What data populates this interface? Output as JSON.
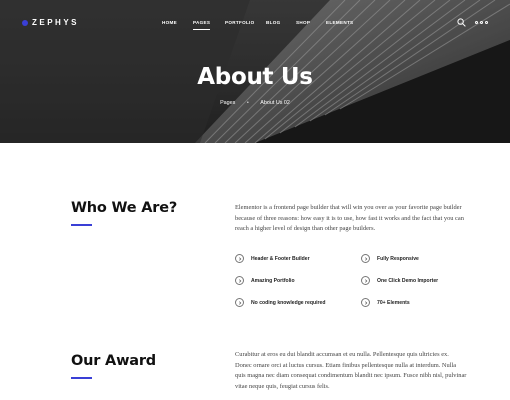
{
  "header": {
    "logo_text": "ZEPHYS",
    "nav": [
      {
        "label": "HOME"
      },
      {
        "label": "PAGES"
      },
      {
        "label": "PORTFOLIO"
      },
      {
        "label": "BLOG"
      },
      {
        "label": "SHOP"
      },
      {
        "label": "ELEMENTS"
      }
    ],
    "active_nav": "PAGES",
    "search_icon": "search-icon",
    "menu_icon": "more-dots-icon"
  },
  "hero": {
    "title": "About Us",
    "breadcrumb": [
      "Pages",
      "About Us 02"
    ]
  },
  "who": {
    "heading": "Who We Are?",
    "text": "Elementor is a frontend page builder that will win you over as your favorite page builder because of three reasons: how easy it is to use, how fast it works and the fact that you can reach a higher level of design than other page builders.",
    "features": [
      {
        "label": "Header & Footer Builder"
      },
      {
        "label": "Fully Responsive"
      },
      {
        "label": "Amazing Portfolio"
      },
      {
        "label": "One Click Demo Importer"
      },
      {
        "label": "No coding knowledge required"
      },
      {
        "label": "70+ Elements"
      }
    ],
    "feature_icon": "chevron-right-circle-icon"
  },
  "award": {
    "heading": "Our Award",
    "text": "Curabitur at eros eu dui blandit accumsan et eu nulla. Pellentesque quis ultricies ex. Donec ornare orci at luctus cursus. Etiam finibus pellentesque nulla at interdum. Nulla quis magna nec diam consequat condimentum blandit nec ipsum. Fusce nibh nisl, pulvinar vitae neque quis, feugiat cursus felis."
  },
  "colors": {
    "accent": "#3a3fd6",
    "heading": "#111111"
  }
}
